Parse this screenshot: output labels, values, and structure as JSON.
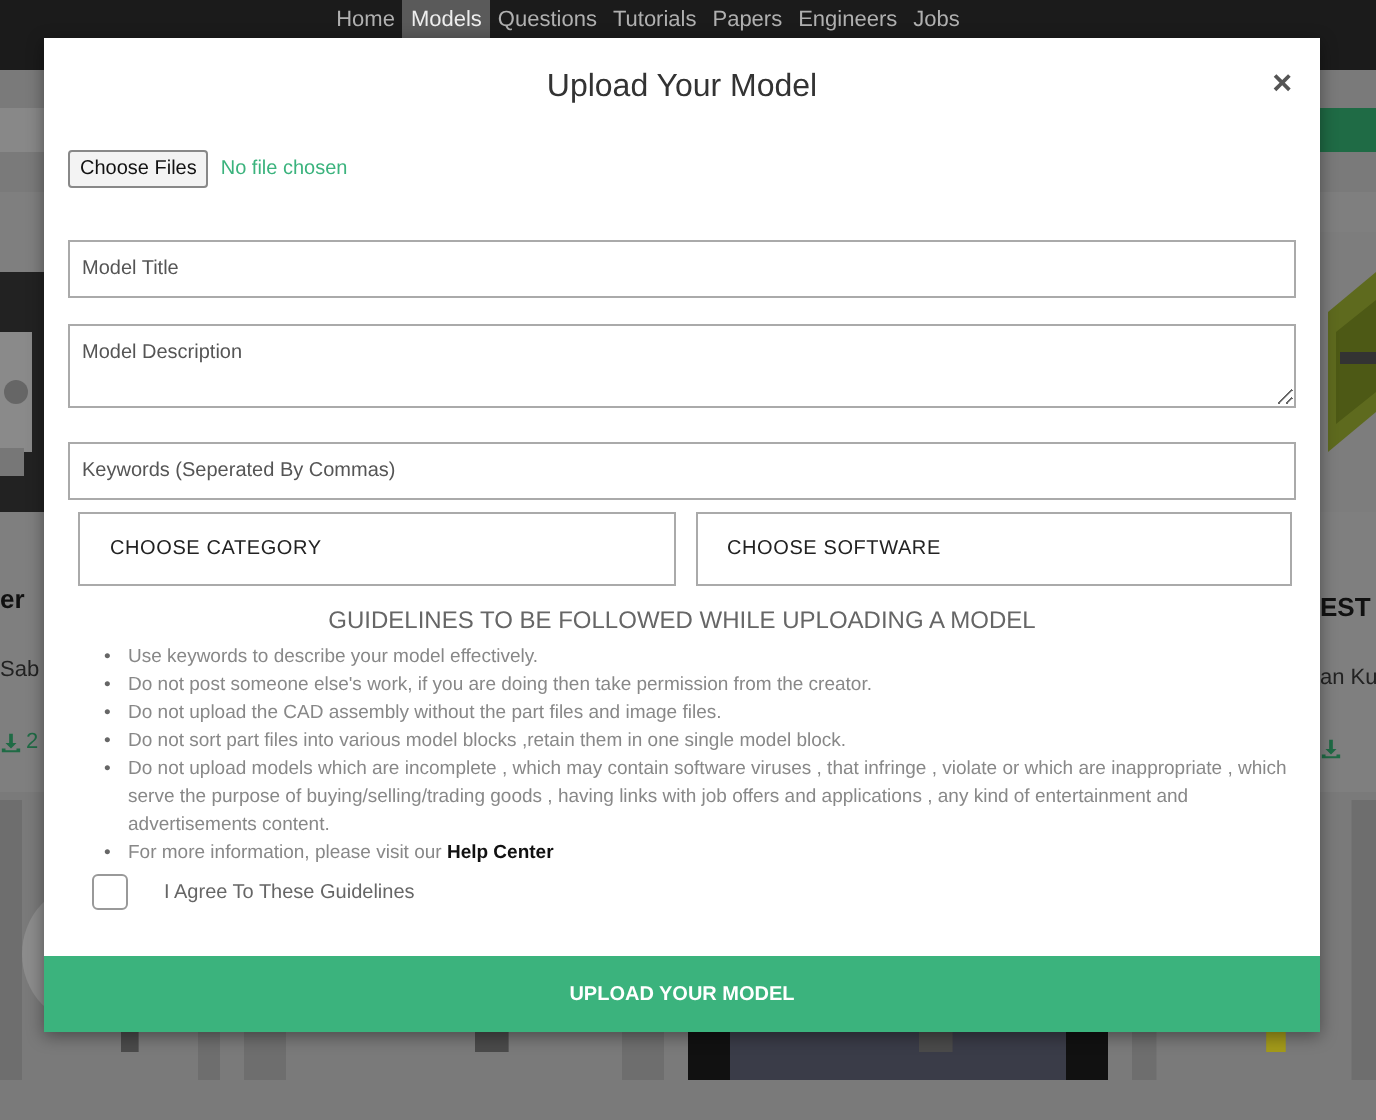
{
  "nav": {
    "items": [
      {
        "label": "Home",
        "selected": false
      },
      {
        "label": "Models",
        "selected": true
      },
      {
        "label": "Questions",
        "selected": false
      },
      {
        "label": "Tutorials",
        "selected": false
      },
      {
        "label": "Papers",
        "selected": false
      },
      {
        "label": "Engineers",
        "selected": false
      },
      {
        "label": "Jobs",
        "selected": false
      }
    ]
  },
  "background": {
    "left_card": {
      "title": "er",
      "author": "Sab",
      "downloads": "2"
    },
    "right_card": {
      "title": "EST",
      "author": "an Ku"
    }
  },
  "modal": {
    "title": "Upload Your Model",
    "close": "×",
    "file_button": "Choose Files",
    "file_status": "No file chosen",
    "fields": [
      {
        "kind": "input",
        "placeholder": "Model Title"
      },
      {
        "kind": "textarea",
        "placeholder": "Model Description"
      },
      {
        "kind": "input",
        "placeholder": "Keywords (Seperated By Commas)"
      }
    ],
    "selects": [
      "CHOOSE CATEGORY",
      "CHOOSE SOFTWARE"
    ],
    "bullet": "•",
    "guidelines_title": "GUIDELINES TO BE FOLLOWED WHILE UPLOADING A MODEL",
    "guidelines": [
      "Use keywords to describe your model effectively.",
      "Do not post someone else's work, if you are doing then take permission from the creator.",
      "Do not upload the CAD assembly without the part files and image files.",
      "Do not sort part files into various model blocks ,retain them in one single model block.",
      "Do not upload models which are incomplete , which may contain software viruses , that infringe , violate or which are inappropriate , which serve the purpose of buying/selling/trading goods , having links with job offers and applications , any kind of entertainment and advertisements content."
    ],
    "more_info": {
      "text": "For more information, please visit our ",
      "link": "Help Center"
    },
    "agree": {
      "label": "I Agree To These Guidelines",
      "checked": false
    },
    "submit": "UPLOAD YOUR MODEL"
  }
}
